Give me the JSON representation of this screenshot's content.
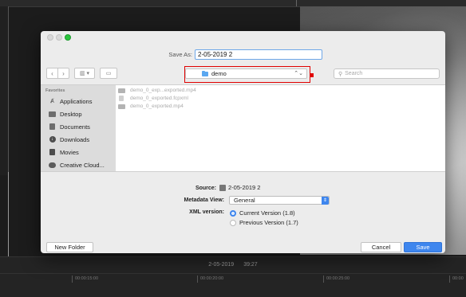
{
  "dialog": {
    "save_as_label": "Save As:",
    "save_as_value": "2-05-2019 2",
    "location": "demo",
    "search_placeholder": "Search",
    "sidebar_header": "Favorites",
    "sidebar_items": [
      {
        "label": "Applications",
        "icon": "applications-icon"
      },
      {
        "label": "Desktop",
        "icon": "desktop-icon"
      },
      {
        "label": "Documents",
        "icon": "documents-icon"
      },
      {
        "label": "Downloads",
        "icon": "downloads-icon"
      },
      {
        "label": "Movies",
        "icon": "movies-icon"
      },
      {
        "label": "Creative Cloud...",
        "icon": "creative-cloud-icon"
      }
    ],
    "files": [
      {
        "name": "demo_0_exp...exported.mp4",
        "type": "video"
      },
      {
        "name": "demo_0_exported.fcpxml",
        "type": "document"
      },
      {
        "name": "demo_0_exported.mp4",
        "type": "video"
      }
    ],
    "source_label": "Source:",
    "source_value": "2-05-2019 2",
    "metadata_label": "Metadata View:",
    "metadata_value": "General",
    "xml_label": "XML version:",
    "xml_options": [
      {
        "label": "Current Version (1.8)",
        "selected": true
      },
      {
        "label": "Previous Version (1.7)",
        "selected": false
      }
    ],
    "new_folder_label": "New Folder",
    "cancel_label": "Cancel",
    "save_label": "Save"
  },
  "timeline": {
    "project_name": "2-05-2019",
    "duration": "39:27",
    "ticks": [
      "00:00:15:00",
      "00:00:20:00",
      "00:00:25:00",
      "00:00"
    ]
  },
  "colors": {
    "accent": "#3e86ee",
    "highlight": "#e00000",
    "green_button": "#2ac43d"
  }
}
